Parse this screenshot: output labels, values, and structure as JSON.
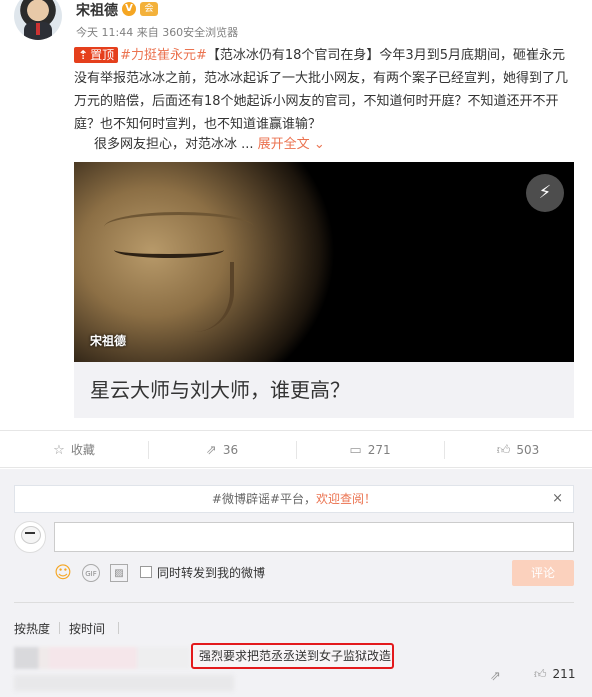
{
  "post": {
    "username": "宋祖德",
    "verified_badge": "V",
    "level_badge": "会",
    "meta": "今天 11:44 来自 360安全浏览器",
    "pin_label": "置顶",
    "hashtag": "#力挺崔永元#",
    "body": "【范冰冰仍有18个官司在身】今年3月到5月底期间，砸崔永元没有举报范冰冰之前，范冰冰起诉了一大批小网友，有两个案子已经宣判，她得到了几万元的赔偿，后面还有18个她起诉小网友的官司，不知道何时开庭？不知道还开不开庭？也不知何时宣判，也不知道谁赢谁输？",
    "second_line": "很多网友担心，对范冰冰 ...",
    "expand_label": "展开全文",
    "expand_icon": "chevron-down-icon"
  },
  "card": {
    "watermark": "宋祖德",
    "title": "星云大师与刘大师，谁更高？",
    "flash_icon": "lightning-icon"
  },
  "actions": {
    "favorite_label": "收藏",
    "repost_count": "36",
    "comment_count": "271",
    "like_count": "503"
  },
  "comments": {
    "notice_prefix": "#微博辟谣#平台，",
    "notice_highlight": "欢迎查阅！",
    "notice_close": "×",
    "repost_checkbox_label": "同时转发到我的微博",
    "submit_label": "评论",
    "sort_hot": "按热度",
    "sort_time": "按时间",
    "top_comment_text": "强烈要求把范丞丞送到女子监狱改造",
    "top_comment_likes": "211"
  },
  "colors": {
    "accent": "#eb7350",
    "pin_red": "#e53f1c",
    "highlight_border": "#e3191c"
  }
}
